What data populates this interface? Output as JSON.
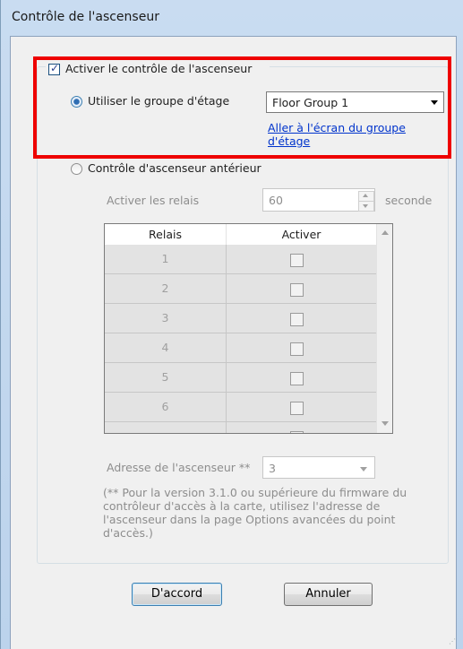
{
  "window": {
    "title": "Contrôle de l'ascenseur"
  },
  "enable": {
    "label": "Activer le contrôle de l'ascenseur",
    "checked": true
  },
  "floor_group": {
    "radio_label": "Utiliser le groupe d'étage",
    "selected": "Floor Group 1",
    "link_line1": "Aller à l'écran du groupe",
    "link_line2": "d'étage"
  },
  "legacy": {
    "radio_label": "Contrôle d'ascenseur antérieur",
    "relay_label": "Activer les relais",
    "relay_value": "60",
    "relay_unit": "seconde"
  },
  "table": {
    "col_relay": "Relais",
    "col_enable": "Activer",
    "rows": [
      "1",
      "2",
      "3",
      "4",
      "5",
      "6"
    ]
  },
  "address": {
    "label": "Adresse de l'ascenseur **",
    "value": "3"
  },
  "note": {
    "line1": "(** Pour la version 3.1.0 ou supérieure du firmware du",
    "line2": "contrôleur d'accès à la carte, utilisez l'adresse de",
    "line3": "l'ascenseur dans la page Options avancées du point",
    "line4": "d'accès.)"
  },
  "buttons": {
    "ok": "D'accord",
    "cancel": "Annuler"
  },
  "colors": {
    "highlight": "#ee0000",
    "link": "#0033cc",
    "accent": "#3c7fb1"
  },
  "icons": [
    "check-icon",
    "radio-selected-icon",
    "radio-icon",
    "chevron-down-icon",
    "spin-up-icon",
    "spin-down-icon",
    "scroll-up-icon",
    "scroll-down-icon"
  ]
}
